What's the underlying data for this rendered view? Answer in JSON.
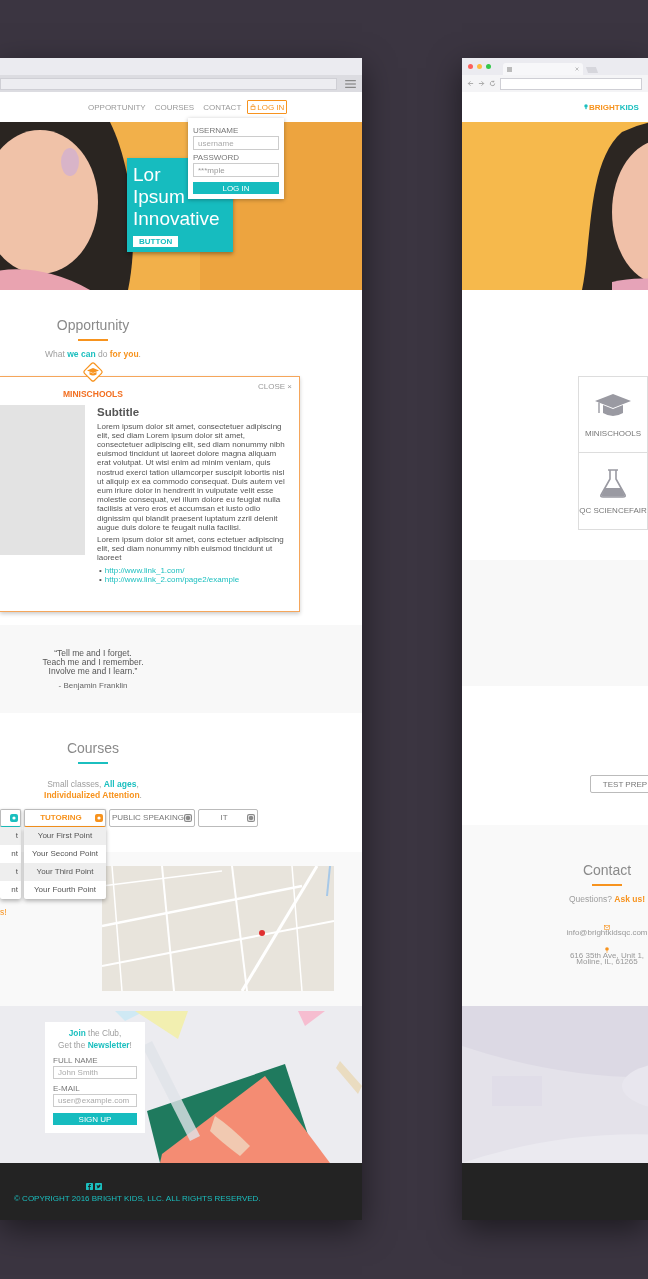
{
  "left_window": {
    "nav": {
      "items": [
        {
          "label": "OPPORTUNITY"
        },
        {
          "label": "COURSES"
        },
        {
          "label": "CONTACT"
        }
      ],
      "login_button": "LOG IN"
    },
    "login_dropdown": {
      "username_label": "USERNAME",
      "username_placeholder": "username",
      "password_label": "PASSWORD",
      "password_value": "***mple",
      "submit": "LOG IN"
    },
    "hero": {
      "heading_lines": [
        "Lor",
        "Ipsum",
        "Innovative"
      ],
      "button": "BUTTON"
    },
    "opportunity": {
      "title": "Opportunity",
      "subtitle": [
        {
          "text": "What "
        },
        {
          "text": "we can",
          "color": "#1bbfbf"
        },
        {
          "text": " do "
        },
        {
          "text": "for you",
          "color": "#f7931e"
        },
        {
          "text": "."
        }
      ]
    },
    "modal": {
      "title": "MINISCHOOLS",
      "close": "CLOSE ×",
      "subtitle": "Subtitle",
      "paragraphs": [
        "Lorem ipsum dolor sit amet, consectetuer adipiscing elit, sed diam Lorem ipsum dolor sit amet, consectetuer adipiscing elit, sed diam nonummy nibh euismod tincidunt ut laoreet dolore magna aliquam erat volutpat. Ut wisi enim ad minim veniam, quis nostrud exerci tation ullamcorper suscipit lobortis nisl ut aliquip ex ea commodo consequat. Duis autem vel eum iriure dolor in hendrerit in vulputate velit esse molestie consequat, vel illum dolore eu feugiat nulla facilisis at vero eros et accumsan et iusto odio dignissim qui blandit praesent luptatum zzril delenit augue duis dolore te feugait nulla facilisi.",
        "Lorem ipsum dolor sit amet, cons ectetuer adipiscing elit, sed diam nonummy nibh euismod tincidunt ut laoreet"
      ],
      "links": [
        {
          "bullet": "•",
          "url": "http://www.link_1.com/"
        },
        {
          "bullet": "•",
          "url": "http://www.link_2.com/page2/example"
        }
      ]
    },
    "quote": {
      "lines": [
        "“Tell me and I forget.",
        "Teach me and I remember.",
        "Involve me and I learn.”"
      ],
      "author": "- Benjamin Franklin"
    },
    "courses": {
      "title": "Courses",
      "subtitle_lines": [
        [
          {
            "text": "Small classes, "
          },
          {
            "text": "All ages",
            "color": "#1bbfbf"
          },
          {
            "text": ","
          }
        ],
        [
          {
            "text": "Individualized Attention",
            "color": "#f7931e"
          },
          {
            "text": "."
          }
        ]
      ],
      "tabs": [
        {
          "selected": true,
          "color": "#1bbfbf",
          "points": [
            "t",
            "nt",
            "t",
            "nt"
          ]
        },
        {
          "label": "TUTORING",
          "selected": true,
          "color": "#f7931e",
          "points": [
            "Your First Point",
            "Your Second Point",
            "Your Third Point",
            "Your Fourth Point"
          ]
        },
        {
          "label": "PUBLIC SPEAKING",
          "selected": false,
          "color": "#8a8a8a"
        },
        {
          "label": "IT",
          "selected": false,
          "color": "#8a8a8a"
        }
      ]
    },
    "contact": {
      "fragment": "s!"
    },
    "newsletter": {
      "heading_lines": [
        [
          {
            "text": "Join",
            "color": "#1bbfbf"
          },
          {
            "text": " the Club,"
          }
        ],
        [
          {
            "text": "Get the "
          },
          {
            "text": "Newsletter",
            "color": "#1bbfbf"
          },
          {
            "text": "!"
          }
        ]
      ],
      "name_label": "FULL NAME",
      "name_placeholder": "John Smith",
      "email_label": "E-MAIL",
      "email_placeholder": "user@example.com",
      "submit": "SIGN UP"
    },
    "footer": {
      "copyright": "© COPYRIGHT 2016 BRIGHT KIDS, LLC. ALL RIGHTS RESERVED."
    }
  },
  "right_window": {
    "logo": [
      {
        "text": "BRIGHT",
        "color": "#f7931e"
      },
      {
        "text": "KIDS",
        "color": "#1bbfbf"
      }
    ],
    "cards": [
      {
        "label": "MINISCHOOLS",
        "kind": "cap"
      },
      {
        "label": "QC SCIENCEFAIR",
        "kind": "flask"
      }
    ],
    "course_tab": "TEST PREP",
    "contact": {
      "title": "Contact",
      "subtitle": [
        {
          "text": "Questions? "
        },
        {
          "text": "Ask us!",
          "color": "#f7931e"
        }
      ],
      "email": "info@brightkidsqc.com",
      "address_lines": [
        "616 35th Ave, Unit 1,",
        "Moline, IL, 61265"
      ]
    }
  }
}
